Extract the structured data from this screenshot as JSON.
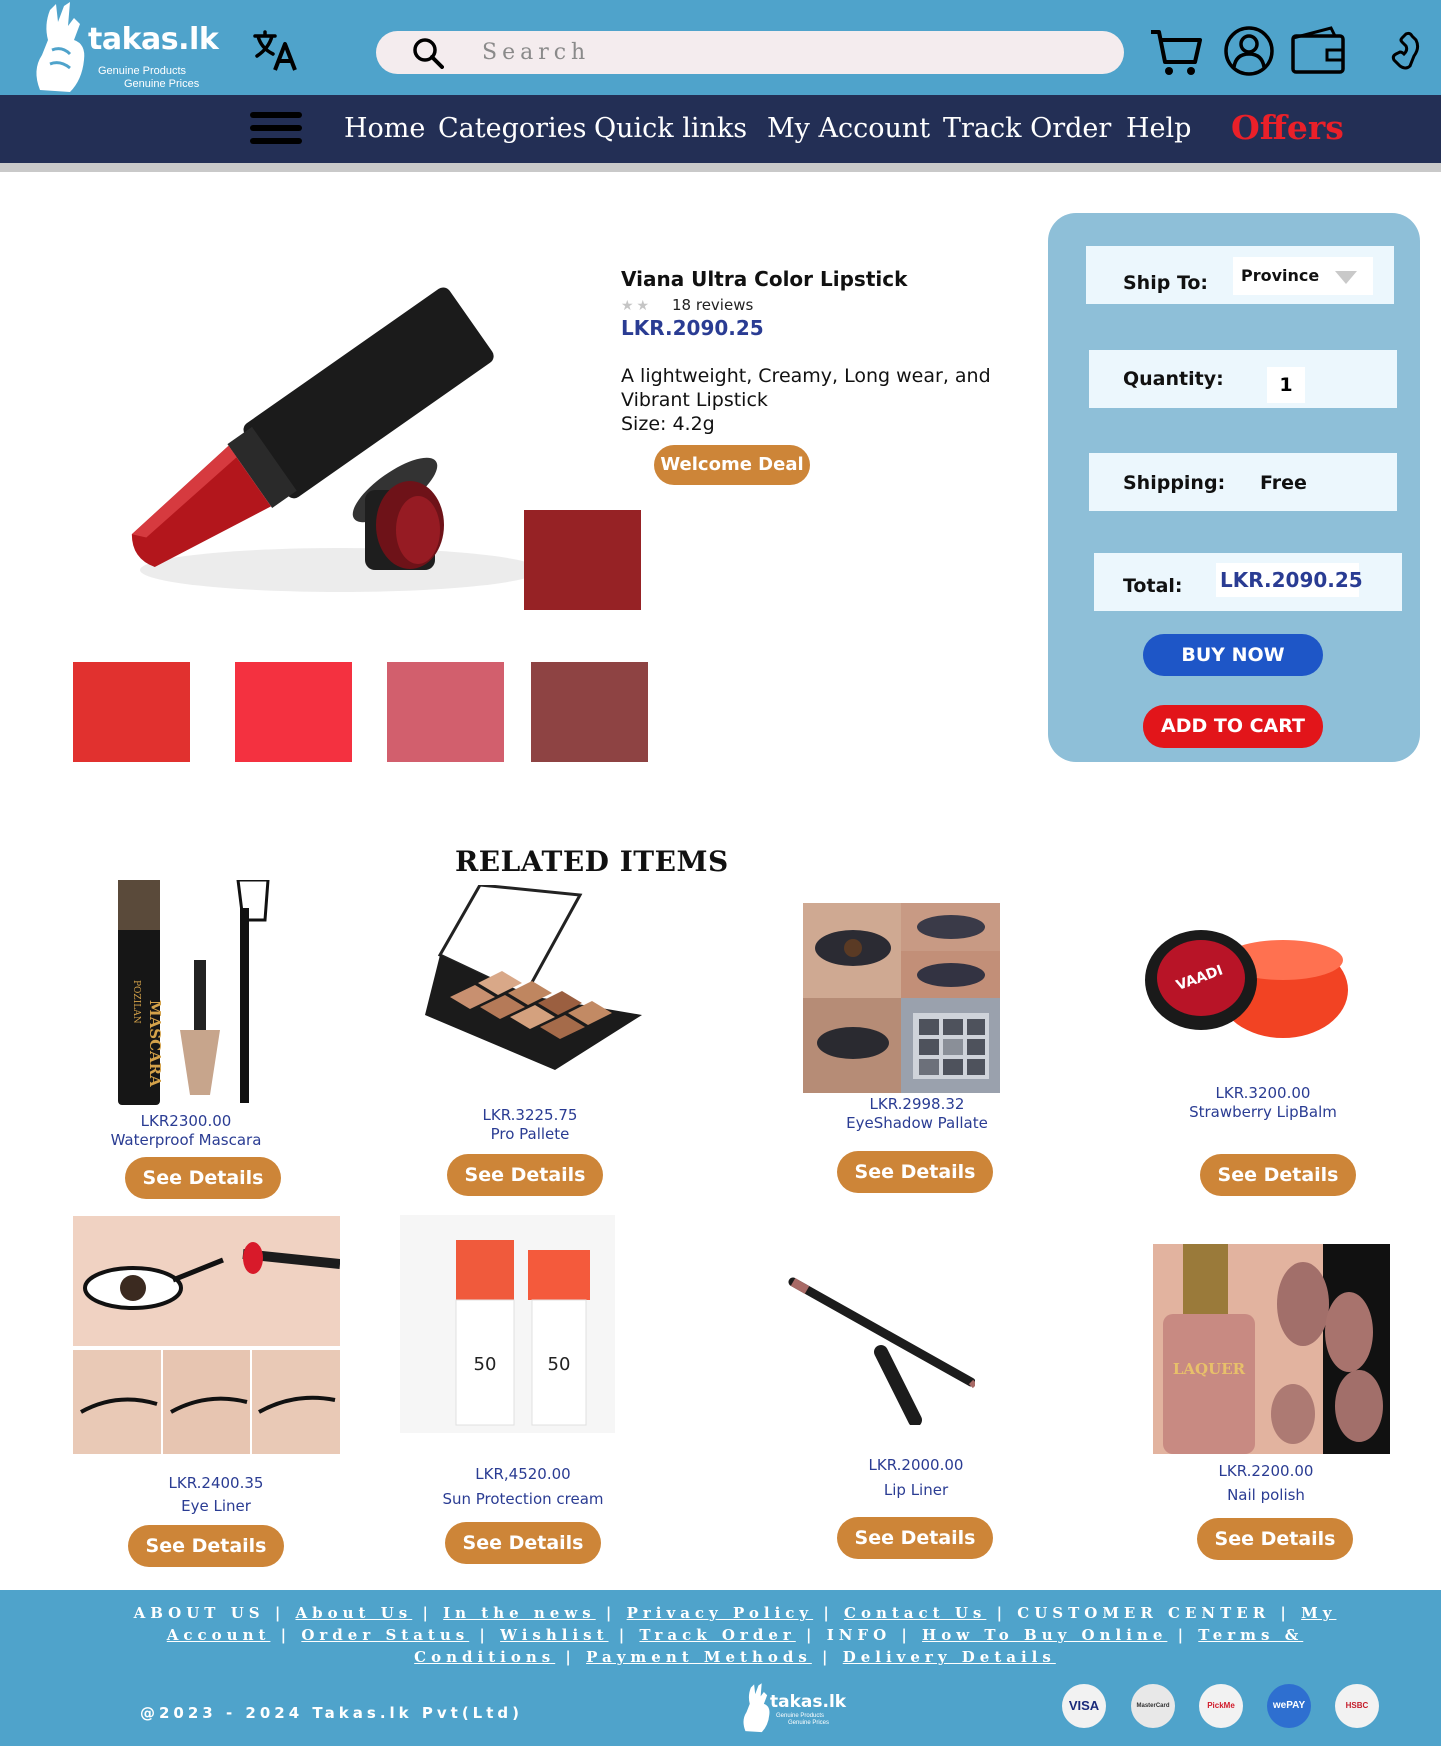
{
  "brand": {
    "name": "takas.lk",
    "tagline_1": "Genuine Products",
    "tagline_2": "Genuine Prices"
  },
  "search": {
    "placeholder": "Search"
  },
  "nav": {
    "items": [
      "Home",
      "Categories",
      "Quick links",
      "My Account",
      "Track Order",
      "Help"
    ],
    "offers": "Offers"
  },
  "product": {
    "title": "Viana Ultra Color Lipstick",
    "reviews": "18 reviews",
    "price": "LKR.2090.25",
    "description_1": "A lightweight, Creamy, Long wear, and",
    "description_2": "Vibrant Lipstick",
    "size": "Size: 4.2g",
    "deal_label": "Welcome Deal",
    "selected_swatch_color": "#962225",
    "swatch_colors": [
      "#e1312f",
      "#f43140",
      "#d25f6d",
      "#8e4343"
    ]
  },
  "order": {
    "ship_to_label": "Ship To:",
    "province_value": "Province",
    "quantity_label": "Quantity:",
    "quantity_value": "1",
    "shipping_label": "Shipping:",
    "shipping_value": "Free",
    "total_label": "Total:",
    "total_value": "LKR.2090.25",
    "buy_now": "BUY NOW",
    "add_to_cart": "ADD TO CART"
  },
  "related": {
    "title": "RELATED ITEMS",
    "see_details": "See Details",
    "items": [
      {
        "price": "LKR2300.00",
        "name": "Waterproof Mascara",
        "icon": "mascara-image"
      },
      {
        "price": "LKR.3225.75",
        "name": "Pro Pallete",
        "icon": "palette-image"
      },
      {
        "price": "LKR.2998.32",
        "name": "EyeShadow Pallate",
        "icon": "eyeshadow-image"
      },
      {
        "price": "LKR.3200.00",
        "name": "Strawberry LipBalm",
        "icon": "lipbalm-image"
      },
      {
        "price": "LKR.2400.35",
        "name": "Eye Liner",
        "icon": "eyeliner-image"
      },
      {
        "price": "LKR,4520.00",
        "name": "Sun Protection cream",
        "icon": "sunscreen-image"
      },
      {
        "price": "LKR.2000.00",
        "name": "Lip Liner",
        "icon": "lipliner-image"
      },
      {
        "price": "LKR.2200.00",
        "name": "Nail polish",
        "icon": "nailpolish-image"
      }
    ],
    "mascara_brand": "POZILAN",
    "mascara_label": "MASCARA",
    "sunscreen_spf": "50",
    "lipbalm_brand": "VAADI",
    "nailpolish_label": "LAQUER"
  },
  "footer": {
    "about_us_heading": "ABOUT US",
    "about_links": [
      "About Us",
      "In the news",
      "Privacy Policy",
      "Contact Us"
    ],
    "customer_center_heading": "CUSTOMER CENTER",
    "customer_links": [
      "My Account",
      "Order Status",
      "Wishlist",
      "Track Order"
    ],
    "info_heading": "INFO",
    "info_links": [
      "How To Buy Online",
      "Terms & Conditions",
      "Payment Methods",
      "Delivery Details"
    ],
    "copyright": "@2023 - 2024 Takas.lk Pvt(Ltd)",
    "payment_methods": [
      {
        "label": "VISA",
        "bg": "#f2f2f2",
        "fg": "#1a2a7a"
      },
      {
        "label": "MasterCard",
        "bg": "#e8e8e8",
        "fg": "#333333"
      },
      {
        "label": "PickMe",
        "bg": "#f2f2f2",
        "fg": "#d11a2a"
      },
      {
        "label": "wePAY",
        "bg": "#2e6fd0",
        "fg": "#ffffff"
      },
      {
        "label": "HSBC",
        "bg": "#f2f2f2",
        "fg": "#c41e2b"
      }
    ]
  },
  "colors": {
    "header_blue": "#4fa3cb",
    "nav_navy": "#232f55",
    "accent_orange": "#cd8538",
    "price_blue": "#2a3c93",
    "offers_red": "#ea2029"
  }
}
